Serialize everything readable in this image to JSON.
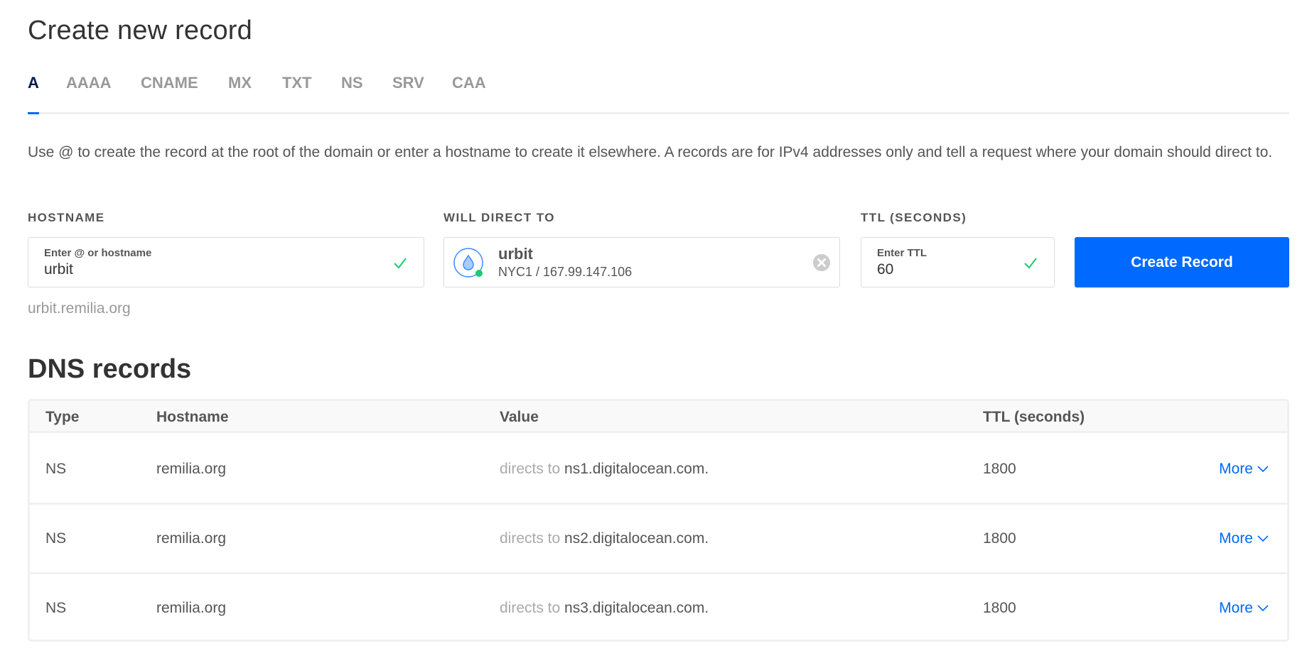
{
  "page_title": "Create new record",
  "tabs": [
    {
      "label": "A",
      "active": true
    },
    {
      "label": "AAAA",
      "active": false
    },
    {
      "label": "CNAME",
      "active": false
    },
    {
      "label": "MX",
      "active": false
    },
    {
      "label": "TXT",
      "active": false
    },
    {
      "label": "NS",
      "active": false
    },
    {
      "label": "SRV",
      "active": false
    },
    {
      "label": "CAA",
      "active": false
    }
  ],
  "description": "Use @ to create the record at the root of the domain or enter a hostname to create it elsewhere. A records are for IPv4 addresses only and tell a request where your domain should direct to.",
  "form": {
    "hostname": {
      "label": "HOSTNAME",
      "placeholder": "Enter @ or hostname",
      "value": "urbit",
      "valid": true,
      "helper": "urbit.remilia.org"
    },
    "direct_to": {
      "label": "WILL DIRECT TO",
      "name": "urbit",
      "detail": "NYC1 / 167.99.147.106",
      "icon": "droplet-icon",
      "status": "online"
    },
    "ttl": {
      "label": "TTL (SECONDS)",
      "placeholder": "Enter TTL",
      "value": "60",
      "valid": true
    },
    "submit_label": "Create Record"
  },
  "dns_records": {
    "title": "DNS records",
    "columns": [
      "Type",
      "Hostname",
      "Value",
      "TTL (seconds)"
    ],
    "rows": [
      {
        "type": "NS",
        "hostname": "remilia.org",
        "value_prefix": "directs to",
        "value": "ns1.digitalocean.com.",
        "ttl": "1800",
        "action": "More"
      },
      {
        "type": "NS",
        "hostname": "remilia.org",
        "value_prefix": "directs to",
        "value": "ns2.digitalocean.com.",
        "ttl": "1800",
        "action": "More"
      },
      {
        "type": "NS",
        "hostname": "remilia.org",
        "value_prefix": "directs to",
        "value": "ns3.digitalocean.com.",
        "ttl": "1800",
        "action": "More"
      }
    ]
  },
  "colors": {
    "accent": "#0069ff",
    "active_tab": "#031b4e",
    "valid": "#15cd72",
    "online": "#15cd72"
  }
}
